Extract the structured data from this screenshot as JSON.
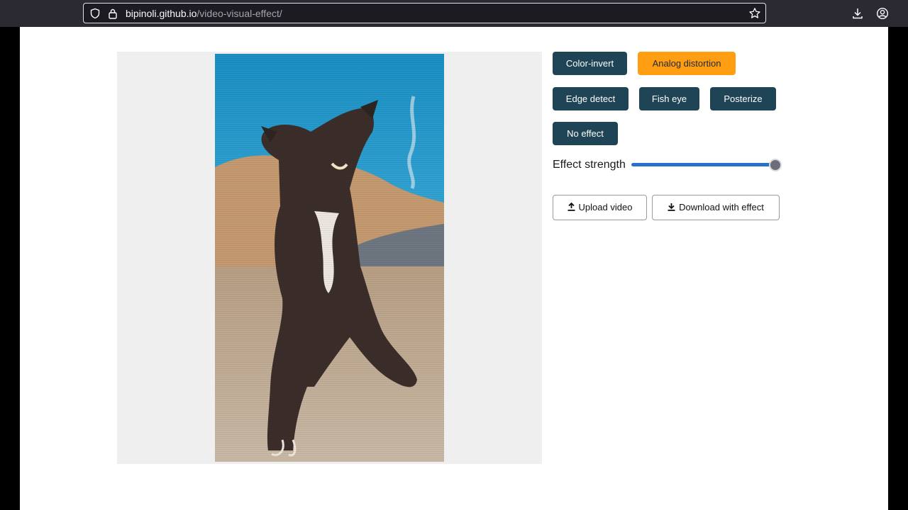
{
  "browser": {
    "url_host": "bipinoli.github.io",
    "url_path": "/video-visual-effect/"
  },
  "effects": {
    "color_invert": "Color-invert",
    "analog_distortion": "Analog distortion",
    "edge_detect": "Edge detect",
    "fish_eye": "Fish eye",
    "posterize": "Posterize",
    "no_effect": "No effect",
    "active": "Analog distortion"
  },
  "strength": {
    "label": "Effect strength",
    "value": 1.0
  },
  "actions": {
    "upload": "Upload video",
    "download": "Download with effect"
  },
  "colors": {
    "button_bg": "#1f4456",
    "button_active_bg": "#ff9e12",
    "slider_track": "#2a6fc9"
  }
}
